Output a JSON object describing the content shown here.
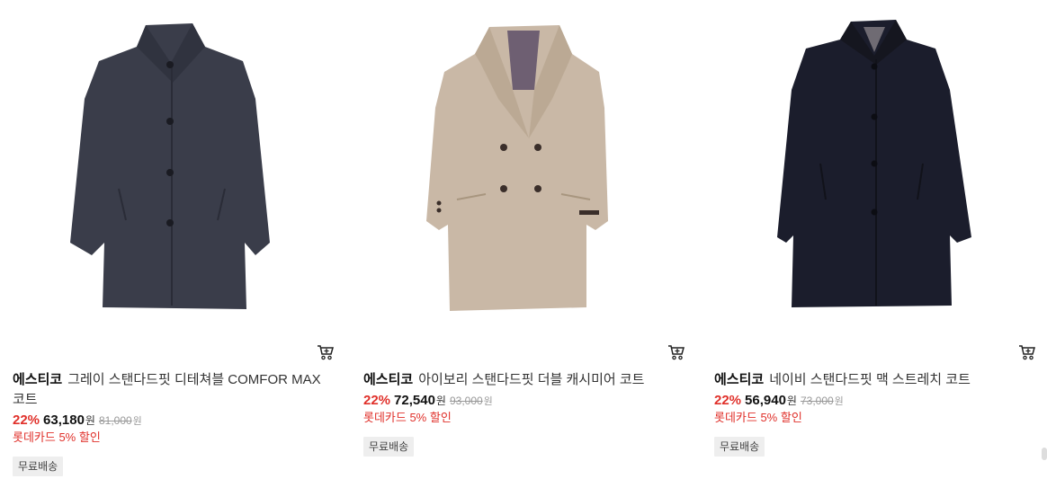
{
  "products": [
    {
      "brand": "에스티코",
      "name": "그레이 스탠다드핏 디테쳐블 COMFOR MAX 코트",
      "discount": "22%",
      "price": "63,180",
      "price_unit": "원",
      "original_price": "81,000",
      "original_unit": "원",
      "card_discount": "롯데카드 5% 할인",
      "shipping_badge": "무료배송",
      "image_icon": "gray-coat-image",
      "coat_color": "#3a3d4a"
    },
    {
      "brand": "에스티코",
      "name": "아이보리 스탠다드핏 더블 캐시미어 코트",
      "discount": "22%",
      "price": "72,540",
      "price_unit": "원",
      "original_price": "93,000",
      "original_unit": "원",
      "card_discount": "롯데카드 5% 할인",
      "shipping_badge": "무료배송",
      "image_icon": "ivory-coat-image",
      "coat_color": "#c9b8a6"
    },
    {
      "brand": "에스티코",
      "name": "네이비 스탠다드핏 맥 스트레치 코트",
      "discount": "22%",
      "price": "56,940",
      "price_unit": "원",
      "original_price": "73,000",
      "original_unit": "원",
      "card_discount": "롯데카드 5% 할인",
      "shipping_badge": "무료배송",
      "image_icon": "navy-coat-image",
      "coat_color": "#1b1d2c"
    }
  ],
  "colors": {
    "discount_red": "#e0302a",
    "badge_bg": "#eeeeee"
  },
  "icons": {
    "cart": "cart-icon"
  }
}
